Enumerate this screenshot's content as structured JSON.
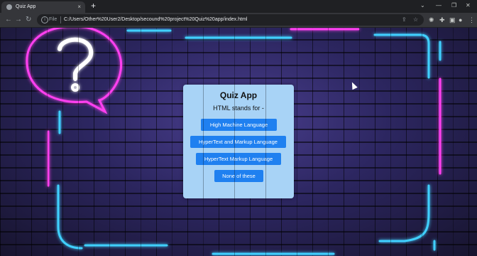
{
  "browser": {
    "tab_title": "Quiz App",
    "tab_close": "×",
    "new_tab": "+",
    "scheme_label": "File",
    "url": "C:/Users/Other%20User2/Desktop/secound%20project%20Quiz%20app/index.html",
    "icons": [
      "back-icon",
      "forward-icon",
      "reload-icon",
      "info-icon",
      "share-icon",
      "star-icon",
      "extension-icon",
      "puzzle-icon",
      "sidebar-icon",
      "profile-icon",
      "menu-icon"
    ],
    "window_controls": [
      "chevron-down-icon",
      "minimize-icon",
      "restore-icon",
      "close-icon"
    ]
  },
  "quiz": {
    "title": "Quiz App",
    "question": "HTML stands for -",
    "options": [
      "High Machine Language",
      "HyperText and Markup Language",
      "HyperText Markup Language",
      "None of these"
    ]
  },
  "colors": {
    "card_bg": "#a8d3f6",
    "button_bg": "#1f80f0",
    "neon_pink": "#ff3ff0",
    "neon_blue": "#3fd0ff"
  }
}
